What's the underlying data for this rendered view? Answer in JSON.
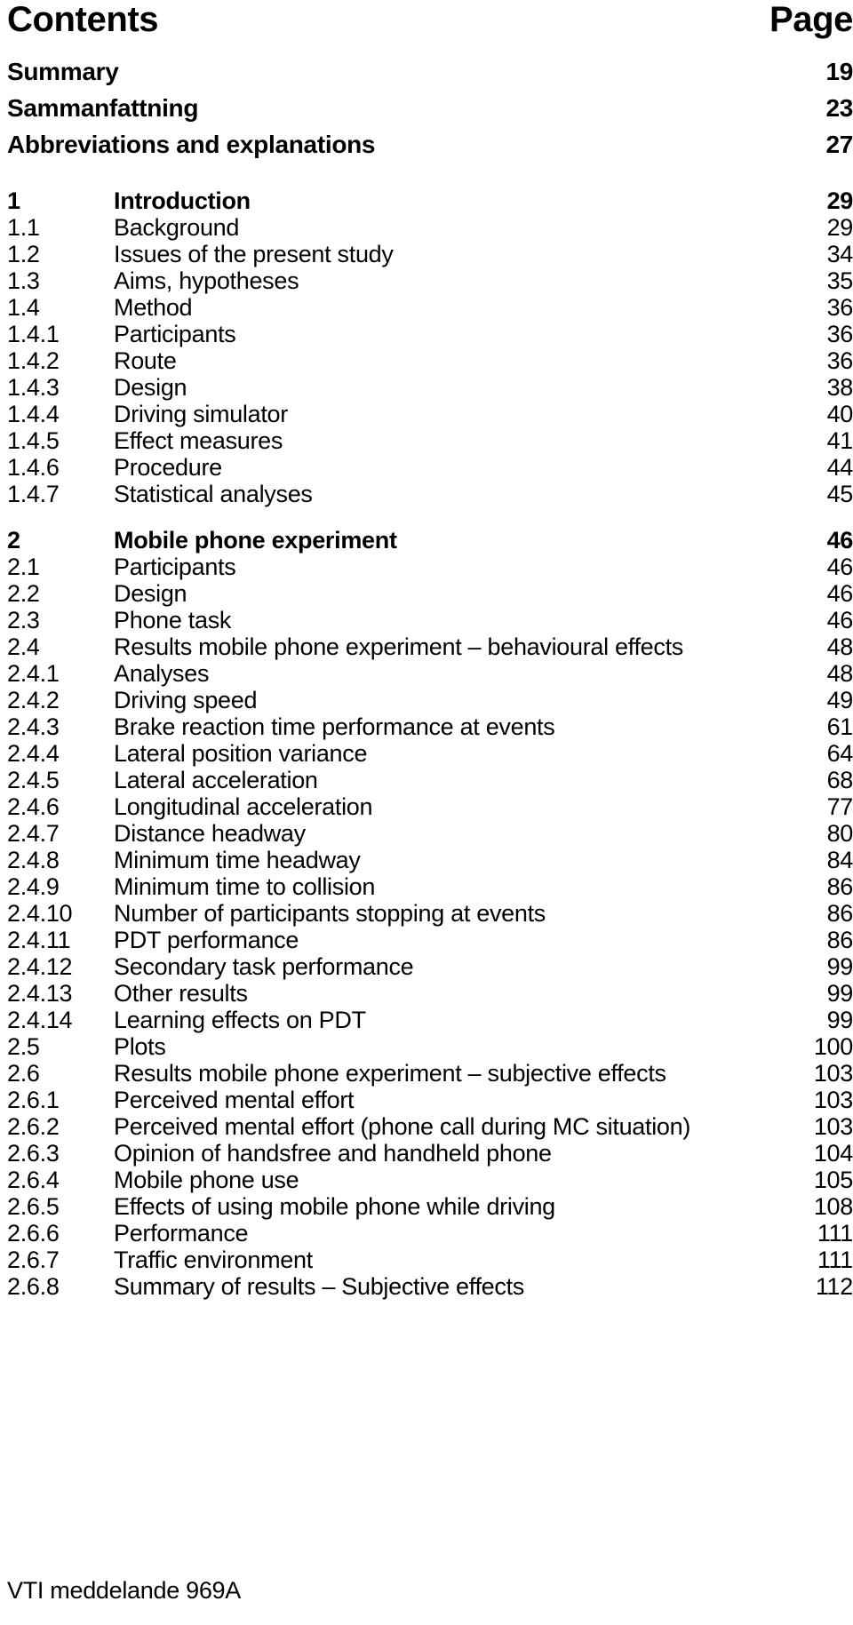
{
  "header": {
    "title": "Contents",
    "page_label": "Page"
  },
  "front_matter": [
    {
      "label": "Summary",
      "page": "19"
    },
    {
      "label": "Sammanfattning",
      "page": "23"
    },
    {
      "label": "Abbreviations and explanations",
      "page": "27"
    }
  ],
  "entries": [
    {
      "num": "1",
      "label": "Introduction",
      "page": "29",
      "level": "chapter"
    },
    {
      "num": "1.1",
      "label": "Background",
      "page": "29",
      "level": "sub"
    },
    {
      "num": "1.2",
      "label": "Issues of the present study",
      "page": "34",
      "level": "sub"
    },
    {
      "num": "1.3",
      "label": "Aims, hypotheses",
      "page": "35",
      "level": "sub"
    },
    {
      "num": "1.4",
      "label": "Method",
      "page": "36",
      "level": "sub"
    },
    {
      "num": "1.4.1",
      "label": "Participants",
      "page": "36",
      "level": "sub"
    },
    {
      "num": "1.4.2",
      "label": "Route",
      "page": "36",
      "level": "sub"
    },
    {
      "num": "1.4.3",
      "label": "Design",
      "page": "38",
      "level": "sub"
    },
    {
      "num": "1.4.4",
      "label": "Driving simulator",
      "page": "40",
      "level": "sub"
    },
    {
      "num": "1.4.5",
      "label": "Effect measures",
      "page": "41",
      "level": "sub"
    },
    {
      "num": "1.4.6",
      "label": "Procedure",
      "page": "44",
      "level": "sub"
    },
    {
      "num": "1.4.7",
      "label": "Statistical analyses",
      "page": "45",
      "level": "sub"
    },
    {
      "num": "2",
      "label": "Mobile phone experiment",
      "page": "46",
      "level": "chapter"
    },
    {
      "num": "2.1",
      "label": "Participants",
      "page": "46",
      "level": "sub"
    },
    {
      "num": "2.2",
      "label": "Design",
      "page": "46",
      "level": "sub"
    },
    {
      "num": "2.3",
      "label": "Phone task",
      "page": "46",
      "level": "sub"
    },
    {
      "num": "2.4",
      "label": "Results mobile phone experiment – behavioural effects",
      "page": "48",
      "level": "sub"
    },
    {
      "num": "2.4.1",
      "label": "Analyses",
      "page": "48",
      "level": "sub"
    },
    {
      "num": "2.4.2",
      "label": "Driving speed",
      "page": "49",
      "level": "sub"
    },
    {
      "num": "2.4.3",
      "label": "Brake reaction time performance at events",
      "page": "61",
      "level": "sub"
    },
    {
      "num": "2.4.4",
      "label": "Lateral position variance",
      "page": "64",
      "level": "sub"
    },
    {
      "num": "2.4.5",
      "label": "Lateral acceleration",
      "page": "68",
      "level": "sub"
    },
    {
      "num": "2.4.6",
      "label": "Longitudinal acceleration",
      "page": "77",
      "level": "sub"
    },
    {
      "num": "2.4.7",
      "label": "Distance headway",
      "page": "80",
      "level": "sub"
    },
    {
      "num": "2.4.8",
      "label": "Minimum time headway",
      "page": "84",
      "level": "sub"
    },
    {
      "num": "2.4.9",
      "label": "Minimum time to collision",
      "page": "86",
      "level": "sub"
    },
    {
      "num": "2.4.10",
      "label": "Number of participants stopping at events",
      "page": "86",
      "level": "sub"
    },
    {
      "num": "2.4.11",
      "label": "PDT performance",
      "page": "86",
      "level": "sub"
    },
    {
      "num": "2.4.12",
      "label": "Secondary task performance",
      "page": "99",
      "level": "sub"
    },
    {
      "num": "2.4.13",
      "label": "Other results",
      "page": "99",
      "level": "sub"
    },
    {
      "num": "2.4.14",
      "label": "Learning effects on PDT",
      "page": "99",
      "level": "sub"
    },
    {
      "num": "2.5",
      "label": "Plots",
      "page": "100",
      "level": "sub"
    },
    {
      "num": "2.6",
      "label": "Results mobile phone experiment – subjective effects",
      "page": "103",
      "level": "sub"
    },
    {
      "num": "2.6.1",
      "label": "Perceived mental effort",
      "page": "103",
      "level": "sub"
    },
    {
      "num": "2.6.2",
      "label": "Perceived mental effort (phone call during MC situation)",
      "page": "103",
      "level": "sub"
    },
    {
      "num": "2.6.3",
      "label": "Opinion of handsfree and handheld phone",
      "page": "104",
      "level": "sub"
    },
    {
      "num": "2.6.4",
      "label": "Mobile phone use",
      "page": "105",
      "level": "sub"
    },
    {
      "num": "2.6.5",
      "label": "Effects of using mobile phone while driving",
      "page": "108",
      "level": "sub"
    },
    {
      "num": "2.6.6",
      "label": "Performance",
      "page": "111",
      "level": "sub"
    },
    {
      "num": "2.6.7",
      "label": "Traffic environment",
      "page": "111",
      "level": "sub"
    },
    {
      "num": "2.6.8",
      "label": "Summary of results – Subjective effects",
      "page": "112",
      "level": "sub"
    }
  ],
  "footer": {
    "text": "VTI meddelande 969A"
  }
}
